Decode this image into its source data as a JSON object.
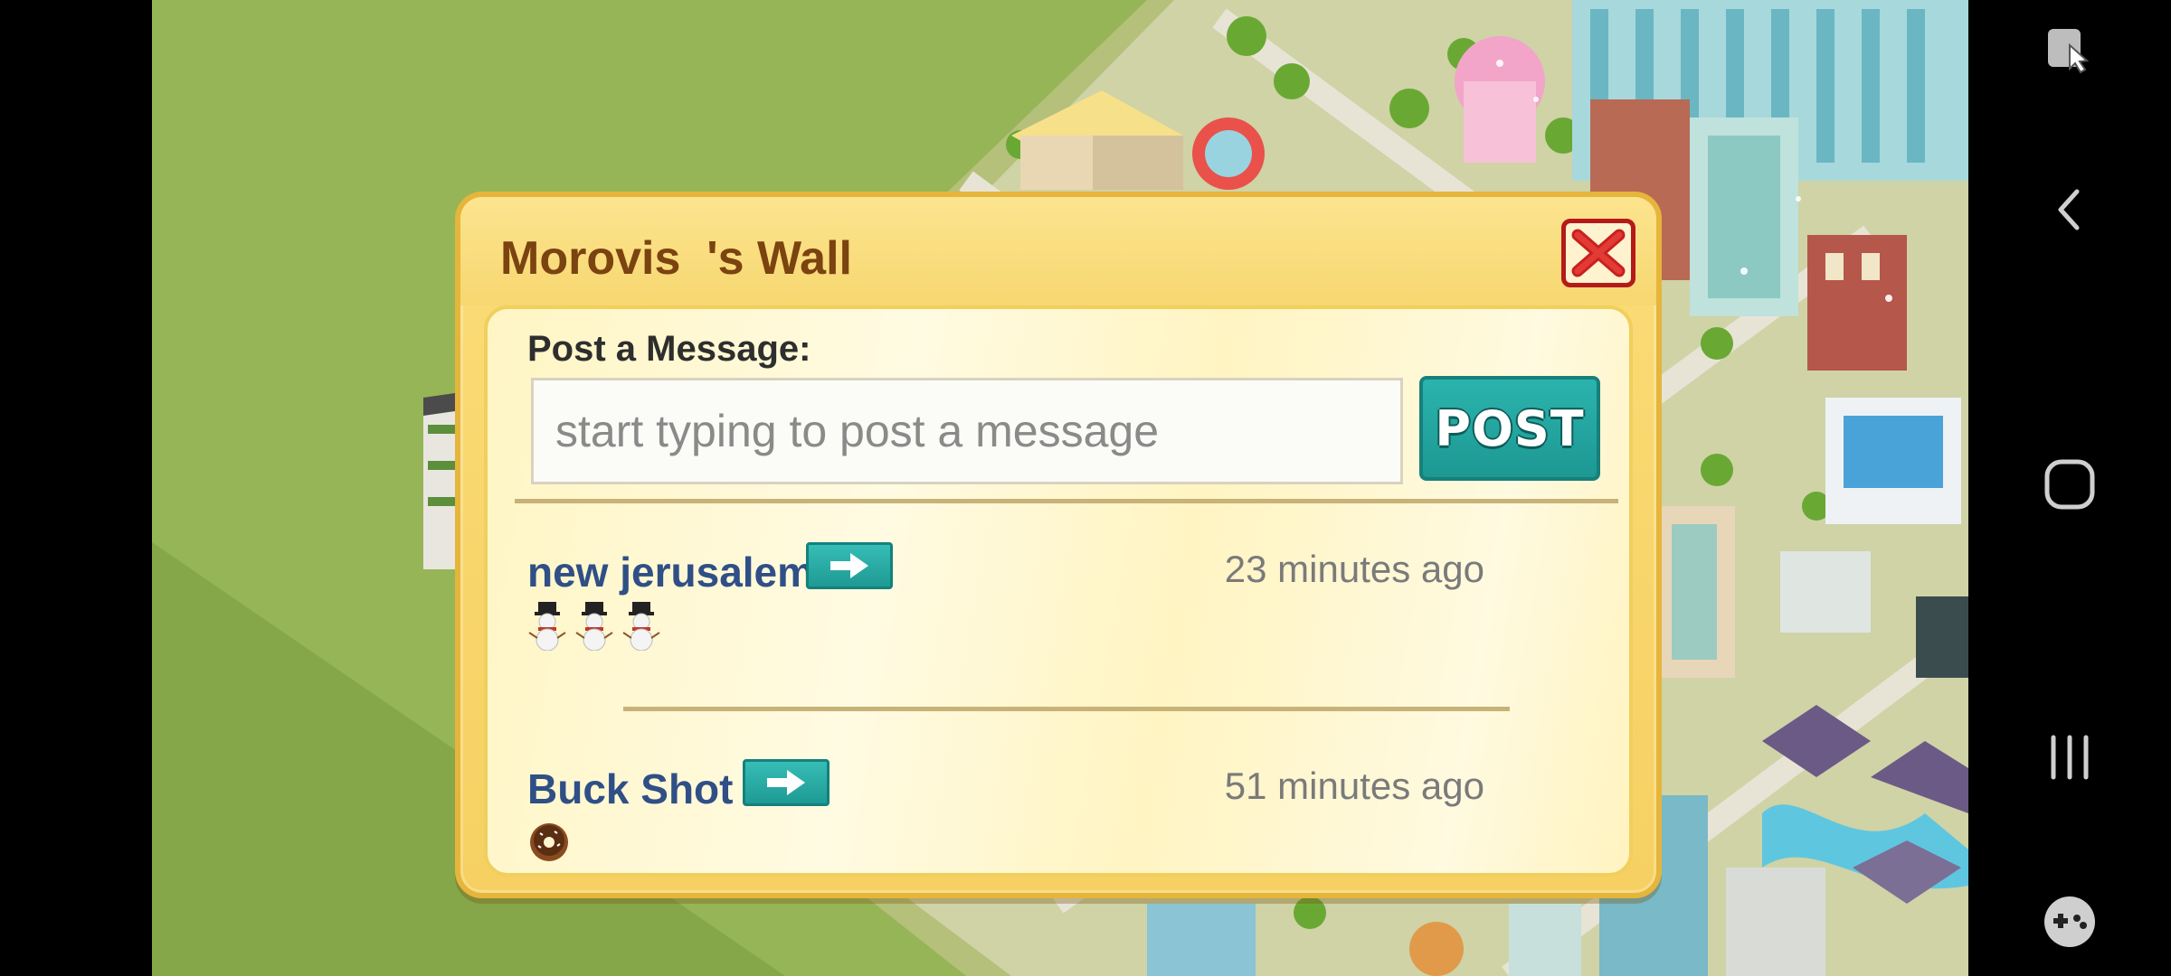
{
  "wall": {
    "title": "Morovis  's Wall",
    "post_label": "Post a Message:",
    "input_placeholder": "start typing to post a message",
    "post_button": "POST"
  },
  "posts": [
    {
      "author": "new jerusalem",
      "time": "23 minutes ago",
      "content_icons": [
        "snowman-icon",
        "snowman-icon",
        "snowman-icon"
      ]
    },
    {
      "author": "Buck Shot",
      "time": "51 minutes ago",
      "content_icons": [
        "donut-icon"
      ]
    }
  ],
  "nav": {
    "items": [
      "screen-control-icon",
      "back-icon",
      "home-icon",
      "recents-icon",
      "game-controller-icon"
    ]
  },
  "colors": {
    "title": "#7a4310",
    "author": "#2f4f86",
    "post_button": "#1d9893",
    "close_border": "#b51a1a",
    "panel": "#fbdc78",
    "ground": "#95b454"
  }
}
